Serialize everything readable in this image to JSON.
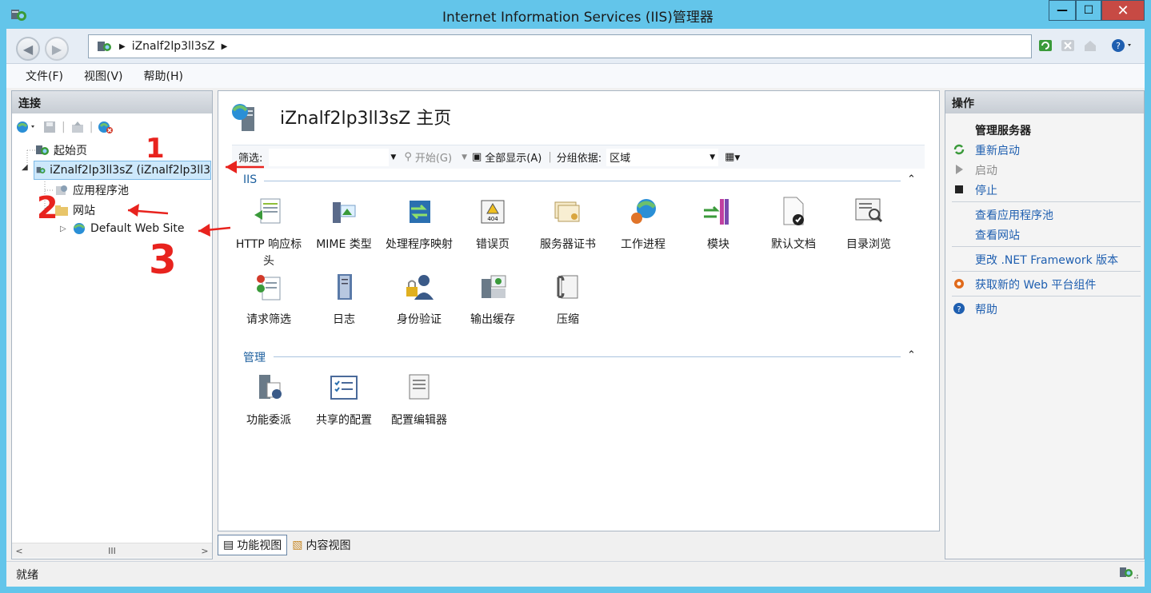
{
  "window": {
    "title": "Internet Information Services (IIS)管理器",
    "minimize": "—",
    "maximize": "☐",
    "close": "✕"
  },
  "address": {
    "path": "iZnalf2lp3ll3sZ"
  },
  "menu": [
    "文件(F)",
    "视图(V)",
    "帮助(H)"
  ],
  "connections": {
    "header": "连接",
    "tree": {
      "start_page": "起始页",
      "server": "iZnalf2lp3ll3sZ (iZnalf2lp3ll3",
      "app_pools": "应用程序池",
      "sites": "网站",
      "default_site": "Default Web Site"
    },
    "scroll_thumb": "III"
  },
  "center": {
    "title": "iZnalf2lp3ll3sZ 主页",
    "filter": {
      "label": "筛选:",
      "start": "开始(G)",
      "show_all": "全部显示(A)",
      "group_label": "分组依据:",
      "group_value": "区域"
    },
    "sections": [
      {
        "name": "IIS",
        "features": [
          "HTTP 响应标头",
          "MIME 类型",
          "处理程序映射",
          "错误页",
          "服务器证书",
          "工作进程",
          "模块",
          "默认文档",
          "目录浏览",
          "请求筛选",
          "日志",
          "身份验证",
          "输出缓存",
          "压缩"
        ]
      },
      {
        "name": "管理",
        "features": [
          "功能委派",
          "共享的配置",
          "配置编辑器"
        ]
      }
    ],
    "view_tabs": [
      "功能视图",
      "内容视图"
    ]
  },
  "actions": {
    "header": "操作",
    "group_title": "管理服务器",
    "items": [
      "重新启动",
      "启动",
      "停止",
      "查看应用程序池",
      "查看网站",
      "更改 .NET Framework 版本",
      "获取新的 Web 平台组件",
      "帮助"
    ]
  },
  "status": {
    "text": "就绪"
  },
  "annotations": [
    "1",
    "2",
    "3"
  ],
  "colors": {
    "title_bar": "#63c5ea",
    "link": "#1f5fb0",
    "annotation": "#e8231e"
  }
}
